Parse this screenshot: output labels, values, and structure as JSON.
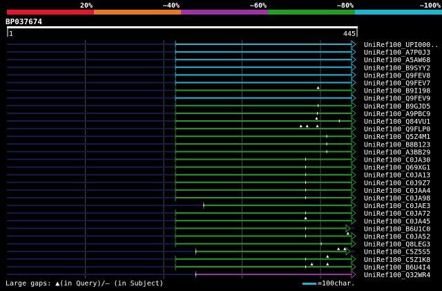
{
  "query_id": "BP037674",
  "footer": {
    "gap_label": "Large gaps: ▲(in Query)/– (in Subject)",
    "scale_label": "=100char."
  },
  "colors": {
    "c20": "#e8142e",
    "c40": "#e8781e",
    "c60": "#a030a8",
    "c80": "#1ea01e",
    "c100": "#16b9d3",
    "track": "#121c55",
    "grid": "#4a4a4a",
    "gap_mark": "#ffffff"
  },
  "chart_data": {
    "type": "alignment",
    "identity_legend": [
      {
        "label": "20%",
        "color": "#e8142e"
      },
      {
        "label": "~40%",
        "color": "#e8781e"
      },
      {
        "label": "~60%",
        "color": "#a030a8"
      },
      {
        "label": "~80%",
        "color": "#1ea01e"
      },
      {
        "label": "~100%",
        "color": "#16b9d3"
      }
    ],
    "query_start_label": "1",
    "query_end_label": "445",
    "query_length": 445,
    "rows": [
      {
        "name": "UniRef100_UPI000..",
        "start": 216,
        "end": 445,
        "identity": 100,
        "gaps": []
      },
      {
        "name": "UniRef100_A7P0J3",
        "start": 216,
        "end": 445,
        "identity": 100,
        "gaps": []
      },
      {
        "name": "UniRef100_A5AW68",
        "start": 216,
        "end": 445,
        "identity": 100,
        "gaps": []
      },
      {
        "name": "UniRef100_B9SYY2",
        "start": 216,
        "end": 445,
        "identity": 100,
        "gaps": []
      },
      {
        "name": "UniRef100_Q9FEV8",
        "start": 216,
        "end": 445,
        "identity": 100,
        "gaps": []
      },
      {
        "name": "UniRef100_Q9FEV7",
        "start": 216,
        "end": 445,
        "identity": 100,
        "gaps": []
      },
      {
        "name": "UniRef100_B9I198",
        "start": 216,
        "end": 445,
        "identity": 80,
        "gaps": [
          {
            "pos": 398,
            "type": "query"
          }
        ]
      },
      {
        "name": "UniRef100_Q9FEV9",
        "start": 216,
        "end": 445,
        "identity": 100,
        "gaps": []
      },
      {
        "name": "UniRef100_B9GJD5",
        "start": 216,
        "end": 445,
        "identity": 80,
        "gaps": [
          {
            "pos": 398,
            "type": "subject"
          }
        ]
      },
      {
        "name": "UniRef100_A9PBC9",
        "start": 216,
        "end": 445,
        "identity": 80,
        "gaps": [
          {
            "pos": 397,
            "type": "subject"
          }
        ]
      },
      {
        "name": "UniRef100_Q84VU1",
        "start": 216,
        "end": 445,
        "identity": 80,
        "gaps": [
          {
            "pos": 396,
            "type": "query"
          },
          {
            "pos": 425,
            "type": "subject"
          }
        ]
      },
      {
        "name": "UniRef100_Q9FLP0",
        "start": 216,
        "end": 445,
        "identity": 80,
        "gaps": [
          {
            "pos": 376,
            "type": "query"
          },
          {
            "pos": 384,
            "type": "query"
          },
          {
            "pos": 397,
            "type": "query"
          }
        ]
      },
      {
        "name": "UniRef100_Q5Z4M1",
        "start": 216,
        "end": 445,
        "identity": 80,
        "gaps": [
          {
            "pos": 409,
            "type": "subject"
          }
        ]
      },
      {
        "name": "UniRef100_B8B123",
        "start": 216,
        "end": 445,
        "identity": 80,
        "gaps": [
          {
            "pos": 409,
            "type": "subject"
          }
        ]
      },
      {
        "name": "UniRef100_A3BB29",
        "start": 216,
        "end": 445,
        "identity": 80,
        "gaps": [
          {
            "pos": 409,
            "type": "subject"
          }
        ]
      },
      {
        "name": "UniRef100_C0JA30",
        "start": 216,
        "end": 445,
        "identity": 80,
        "gaps": [
          {
            "pos": 382,
            "type": "subject"
          }
        ]
      },
      {
        "name": "UniRef100_Q69XG1",
        "start": 216,
        "end": 445,
        "identity": 80,
        "gaps": [
          {
            "pos": 382,
            "type": "subject"
          }
        ]
      },
      {
        "name": "UniRef100_C0JA13",
        "start": 216,
        "end": 445,
        "identity": 80,
        "gaps": [
          {
            "pos": 382,
            "type": "subject"
          }
        ]
      },
      {
        "name": "UniRef100_C0J9Z7",
        "start": 216,
        "end": 445,
        "identity": 80,
        "gaps": [
          {
            "pos": 382,
            "type": "subject"
          }
        ]
      },
      {
        "name": "UniRef100_C0JAA4",
        "start": 216,
        "end": 445,
        "identity": 80,
        "gaps": [
          {
            "pos": 382,
            "type": "subject"
          }
        ]
      },
      {
        "name": "UniRef100_C0JA98",
        "start": 216,
        "end": 445,
        "identity": 80,
        "gaps": [
          {
            "pos": 382,
            "type": "subject"
          }
        ]
      },
      {
        "name": "UniRef100_C0JAE3",
        "start": 252,
        "end": 445,
        "identity": 80,
        "gaps": [
          {
            "pos": 252,
            "type": "subject"
          }
        ]
      },
      {
        "name": "UniRef100_C0JA72",
        "start": 216,
        "end": 445,
        "identity": 80,
        "gaps": [
          {
            "pos": 382,
            "type": "subject"
          }
        ]
      },
      {
        "name": "UniRef100_C0JA45",
        "start": 216,
        "end": 445,
        "identity": 80,
        "gaps": [
          {
            "pos": 382,
            "type": "query"
          }
        ]
      },
      {
        "name": "UniRef100_B6U1C0",
        "start": 216,
        "end": 438,
        "identity": 80,
        "gaps": [
          {
            "pos": 382,
            "type": "subject"
          }
        ]
      },
      {
        "name": "UniRef100_C0JA52",
        "start": 216,
        "end": 445,
        "identity": 80,
        "gaps": [
          {
            "pos": 382,
            "type": "subject"
          },
          {
            "pos": 436,
            "type": "query"
          }
        ]
      },
      {
        "name": "UniRef100_Q8LEG3",
        "start": 216,
        "end": 445,
        "identity": 80,
        "gaps": [
          {
            "pos": 402,
            "type": "subject"
          }
        ]
      },
      {
        "name": "UniRef100_C5Z5S5",
        "start": 242,
        "end": 438,
        "identity": 80,
        "gaps": [
          {
            "pos": 242,
            "type": "subject"
          },
          {
            "pos": 424,
            "type": "query"
          },
          {
            "pos": 432,
            "type": "query"
          }
        ]
      },
      {
        "name": "UniRef100_C5Z1K8",
        "start": 216,
        "end": 445,
        "identity": 80,
        "gaps": [
          {
            "pos": 382,
            "type": "subject"
          },
          {
            "pos": 410,
            "type": "query"
          }
        ]
      },
      {
        "name": "UniRef100_B6U4I4",
        "start": 216,
        "end": 445,
        "identity": 80,
        "gaps": [
          {
            "pos": 382,
            "type": "subject"
          },
          {
            "pos": 390,
            "type": "query"
          },
          {
            "pos": 410,
            "type": "query"
          }
        ]
      },
      {
        "name": "UniRef100_Q32WR4",
        "start": 242,
        "end": 445,
        "identity": 60,
        "gaps": [
          {
            "pos": 242,
            "type": "subject"
          }
        ]
      }
    ]
  }
}
